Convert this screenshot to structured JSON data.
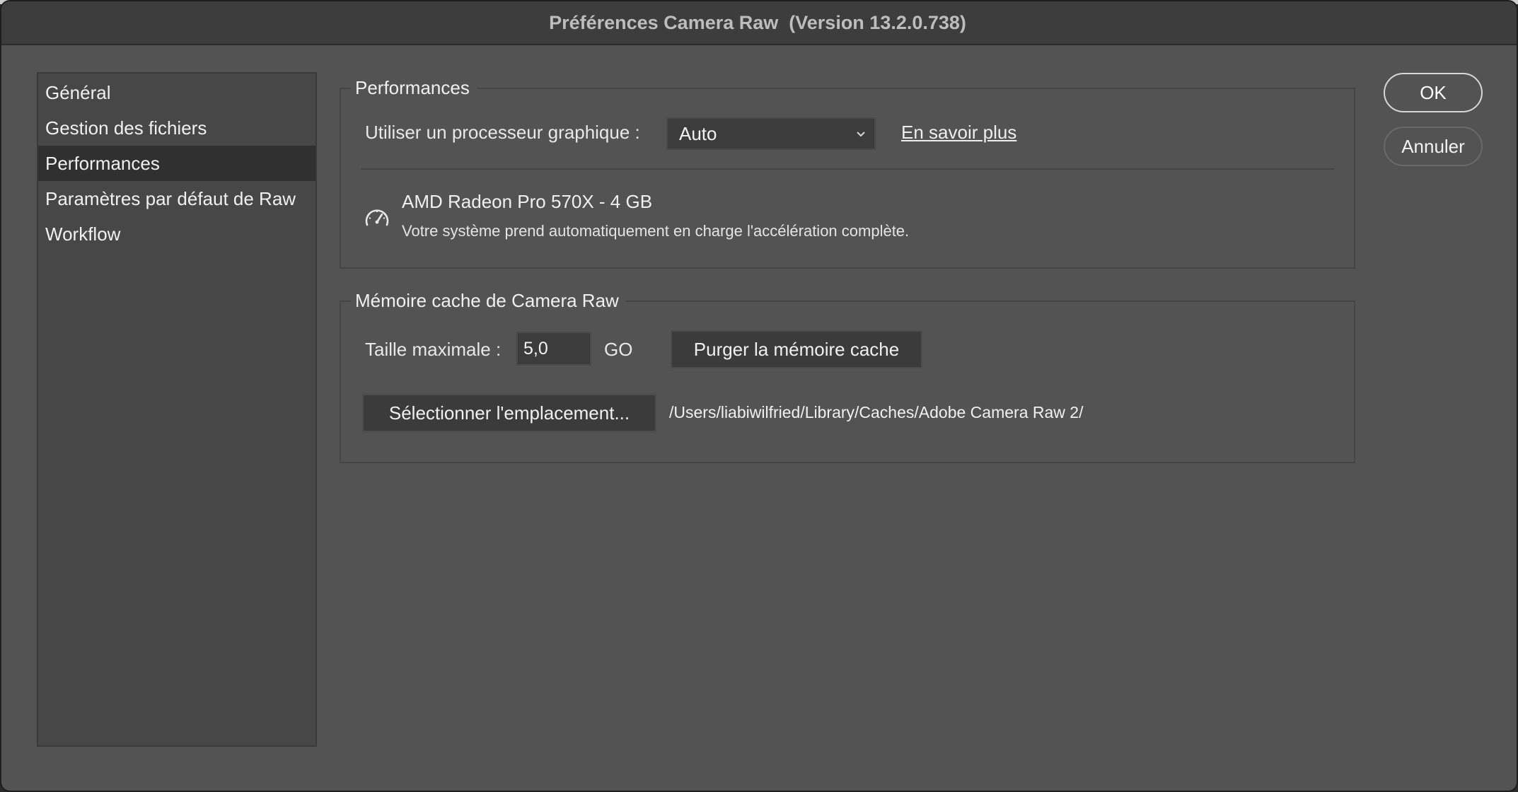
{
  "window": {
    "title": "Préférences Camera Raw  (Version 13.2.0.738)"
  },
  "sidebar": {
    "items": [
      {
        "label": "Général"
      },
      {
        "label": "Gestion des fichiers"
      },
      {
        "label": "Performances",
        "selected": true
      },
      {
        "label": "Paramètres par défaut de Raw"
      },
      {
        "label": "Workflow"
      }
    ]
  },
  "performance": {
    "legend": "Performances",
    "gpu_label": "Utiliser un processeur graphique :",
    "gpu_select_value": "Auto",
    "learn_more_link": "En savoir plus",
    "gpu_name": "AMD Radeon Pro 570X - 4 GB",
    "gpu_status": "Votre système prend automatiquement en charge l'accélération complète.",
    "gpu_icon": "speedometer-icon"
  },
  "cache": {
    "legend": "Mémoire cache de Camera Raw",
    "max_size_label": "Taille maximale :",
    "max_size_value": "5,0",
    "unit": "GO",
    "purge_button": "Purger la mémoire cache",
    "select_location_button": "Sélectionner l'emplacement...",
    "location_path": "/Users/liabiwilfried/Library/Caches/Adobe Camera Raw 2/"
  },
  "buttons": {
    "ok": "OK",
    "cancel": "Annuler"
  }
}
